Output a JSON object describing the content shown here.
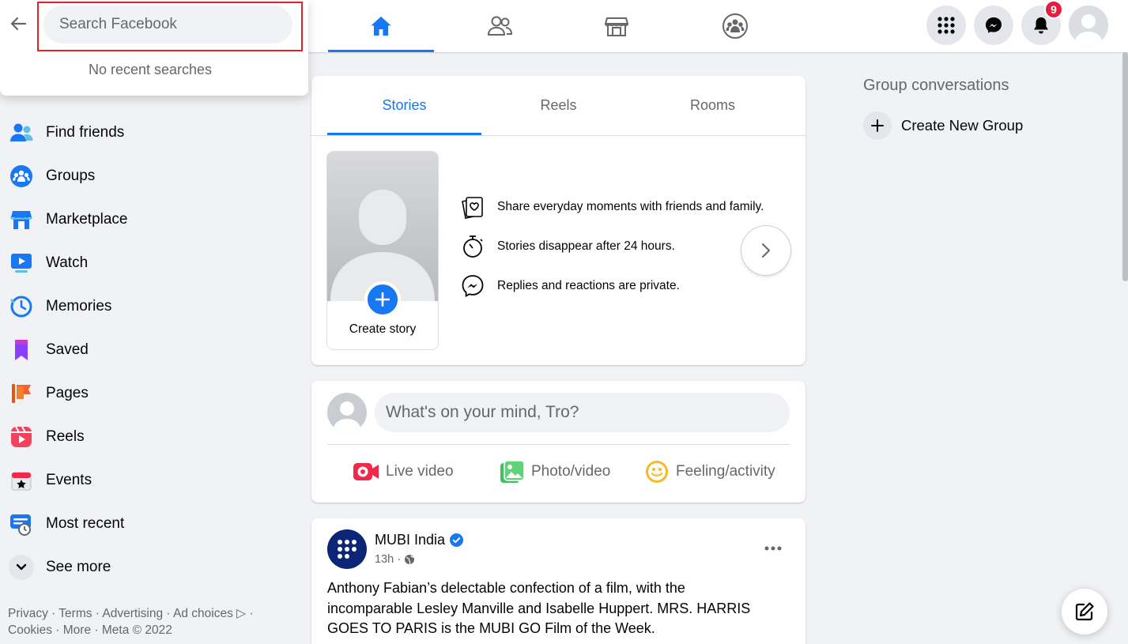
{
  "search": {
    "placeholder": "Search Facebook",
    "empty_text": "No recent searches"
  },
  "top_nav": {
    "tabs": [
      "home-icon",
      "friends-icon",
      "marketplace-icon",
      "groups-icon"
    ],
    "notification_count": "9"
  },
  "sidebar": {
    "items": [
      {
        "label": "Find friends",
        "icon": "friends-icon"
      },
      {
        "label": "Groups",
        "icon": "groups-icon"
      },
      {
        "label": "Marketplace",
        "icon": "marketplace-icon"
      },
      {
        "label": "Watch",
        "icon": "watch-icon"
      },
      {
        "label": "Memories",
        "icon": "memories-icon"
      },
      {
        "label": "Saved",
        "icon": "saved-icon"
      },
      {
        "label": "Pages",
        "icon": "pages-icon"
      },
      {
        "label": "Reels",
        "icon": "reels-icon"
      },
      {
        "label": "Events",
        "icon": "events-icon"
      },
      {
        "label": "Most recent",
        "icon": "most-recent-icon"
      },
      {
        "label": "See more",
        "icon": "chevron-down-icon"
      }
    ],
    "footer": "Privacy · Terms · Advertising · Ad choices ▷ · Cookies · More · Meta © 2022"
  },
  "stories": {
    "tabs": [
      "Stories",
      "Reels",
      "Rooms"
    ],
    "create_label": "Create story",
    "info": [
      "Share everyday moments with friends and family.",
      "Stories disappear after 24 hours.",
      "Replies and reactions are private."
    ]
  },
  "composer": {
    "placeholder": "What's on your mind, Tro?",
    "actions": [
      "Live video",
      "Photo/video",
      "Feeling/activity"
    ]
  },
  "post": {
    "author": "MUBI India",
    "time": "13h ·",
    "text": "Anthony Fabian’s delectable confection of a film, with the incomparable Lesley Manville and Isabelle Huppert. MRS. HARRIS GOES TO PARIS is the MUBI GO Film of the Week."
  },
  "right_panel": {
    "heading": "Group conversations",
    "create_label": "Create New Group"
  },
  "colors": {
    "accent": "#1877f2",
    "badge": "#e41e3f",
    "highlight_outline": "#e0202b"
  }
}
